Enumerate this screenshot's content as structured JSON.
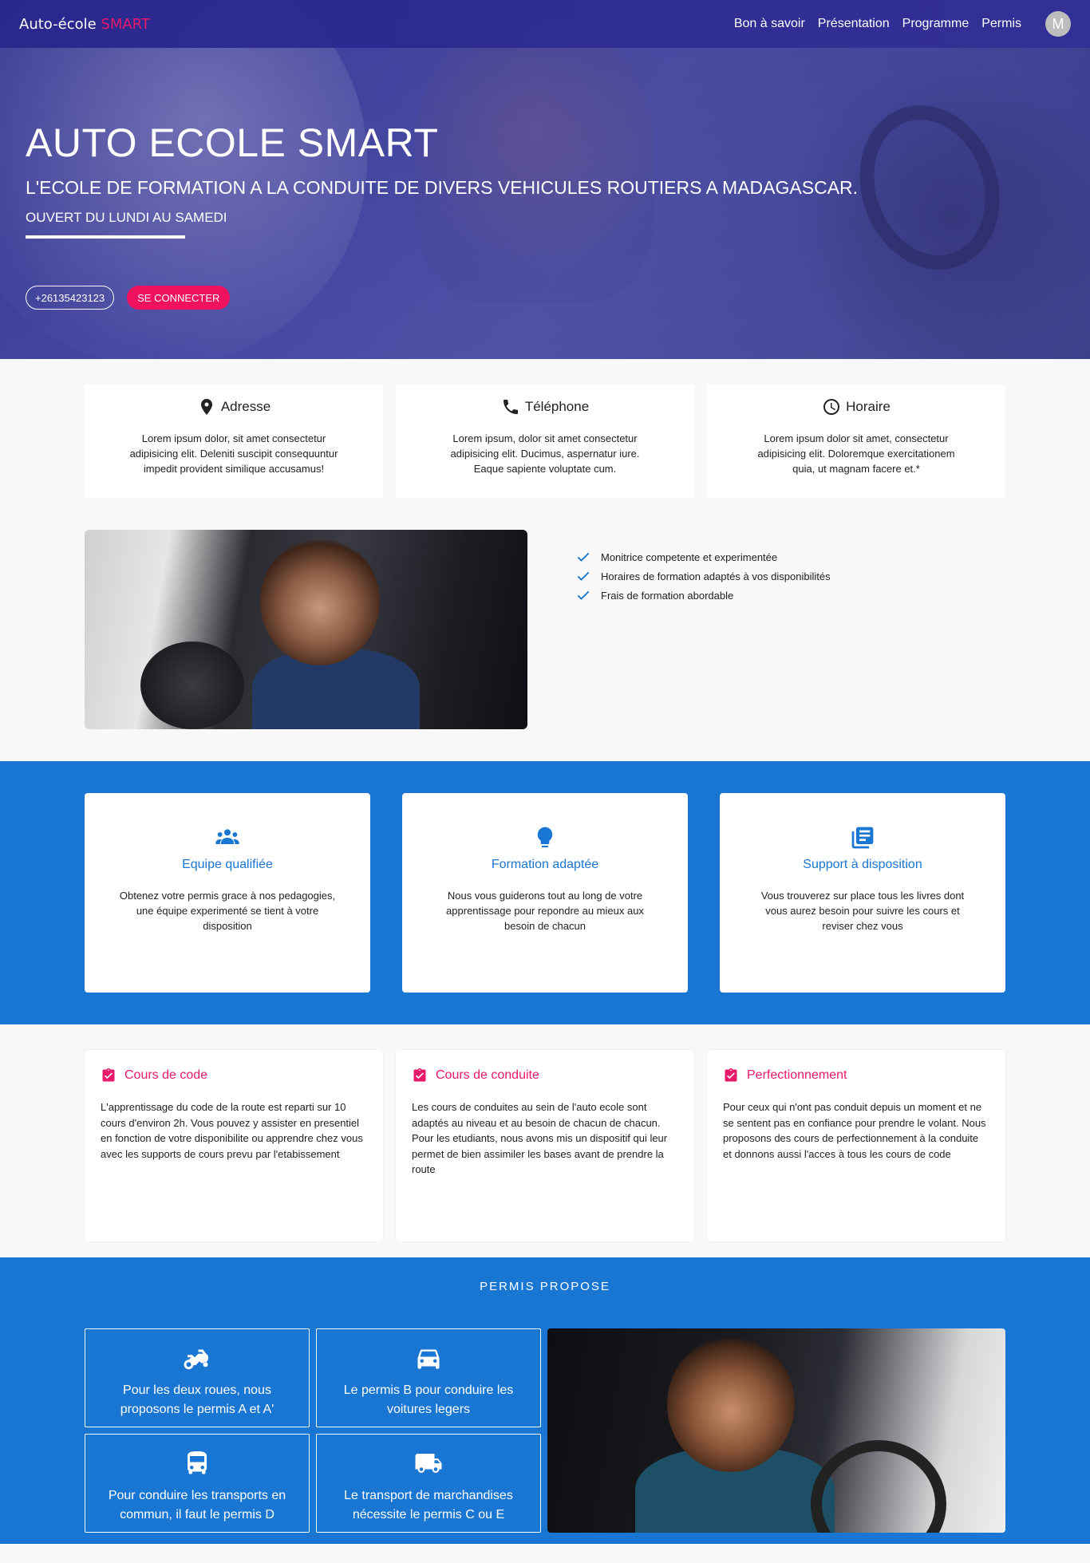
{
  "nav": {
    "brand_main": "Auto-école ",
    "brand_accent": "SMART",
    "links": [
      "Bon à savoir",
      "Présentation",
      "Programme",
      "Permis"
    ],
    "avatar_initial": "M"
  },
  "hero": {
    "title": "AUTO ECOLE SMART",
    "subtitle": "L'ECOLE DE FORMATION A LA CONDUITE DE DIVERS VEHICULES ROUTIERS A MADAGASCAR.",
    "hours": "OUVERT DU LUNDI AU SAMEDI",
    "phone_button": "+26135423123",
    "login_button": "SE CONNECTER"
  },
  "info_cards": [
    {
      "title": "Adresse",
      "icon": "location-pin-icon",
      "text": "Lorem ipsum dolor, sit amet consectetur adipisicing elit. Deleniti suscipit consequuntur impedit provident similique accusamus!"
    },
    {
      "title": "Téléphone",
      "icon": "phone-icon",
      "text": "Lorem ipsum, dolor sit amet consectetur adipisicing elit. Ducimus, aspernatur iure. Eaque sapiente voluptate cum."
    },
    {
      "title": "Horaire",
      "icon": "clock-icon",
      "text": "Lorem ipsum dolor sit amet, consectetur adipisicing elit. Doloremque exercitationem quia, ut magnam facere et.*"
    }
  ],
  "features": [
    "Monitrice competente et experimentée",
    "Horaires de formation adaptés à vos disponibilités",
    "Frais de formation abordable"
  ],
  "services": [
    {
      "title": "Equipe qualifiée",
      "icon": "group-icon",
      "text": "Obtenez votre permis grace à nos pedagogies, une équipe experimenté se tient à votre disposition"
    },
    {
      "title": "Formation adaptée",
      "icon": "lightbulb-icon",
      "text": "Nous vous guiderons tout au long de votre apprentissage pour repondre au mieux aux besoin de chacun"
    },
    {
      "title": "Support à disposition",
      "icon": "library-books-icon",
      "text": "Vous trouverez sur place tous les livres dont vous aurez besoin pour suivre les cours et reviser chez vous"
    }
  ],
  "courses": [
    {
      "title": "Cours de code",
      "icon": "clipboard-check-icon",
      "text": "L'apprentissage du code de la route est reparti sur 10 cours d'environ 2h. Vous pouvez y assister en presentiel en fonction de votre disponibilite ou apprendre chez vous avec les supports de cours prevu par l'etabissement"
    },
    {
      "title": "Cours de conduite",
      "icon": "clipboard-check-icon",
      "text": "Les cours de conduites au sein de l'auto ecole sont adaptés au niveau et au besoin de chacun de chacun. Pour les etudiants, nous avons mis un dispositif qui leur permet de bien assimiler les bases avant de prendre la route"
    },
    {
      "title": "Perfectionnement",
      "icon": "clipboard-check-icon",
      "text": "Pour ceux qui n'ont pas conduit depuis un moment et ne se sentent pas en confiance pour prendre le volant. Nous proposons des cours de perfectionnement à la conduite et donnons aussi l'acces à tous les cours de code"
    }
  ],
  "permis": {
    "title": "PERMIS PROPOSE",
    "items": [
      {
        "icon": "motorcycle-icon",
        "text": "Pour les deux roues, nous proposons le permis A et A'"
      },
      {
        "icon": "car-icon",
        "text": "Le permis B pour conduire les voitures legers"
      },
      {
        "icon": "bus-icon",
        "text": "Pour conduire les transports en commun, il faut le permis D"
      },
      {
        "icon": "truck-icon",
        "text": "Le transport de marchandises nécessite le permis C ou E"
      }
    ]
  },
  "colors": {
    "accent_pink": "#e8196b",
    "primary_blue": "#1976d2",
    "nav_indigo": "#2b298c"
  }
}
